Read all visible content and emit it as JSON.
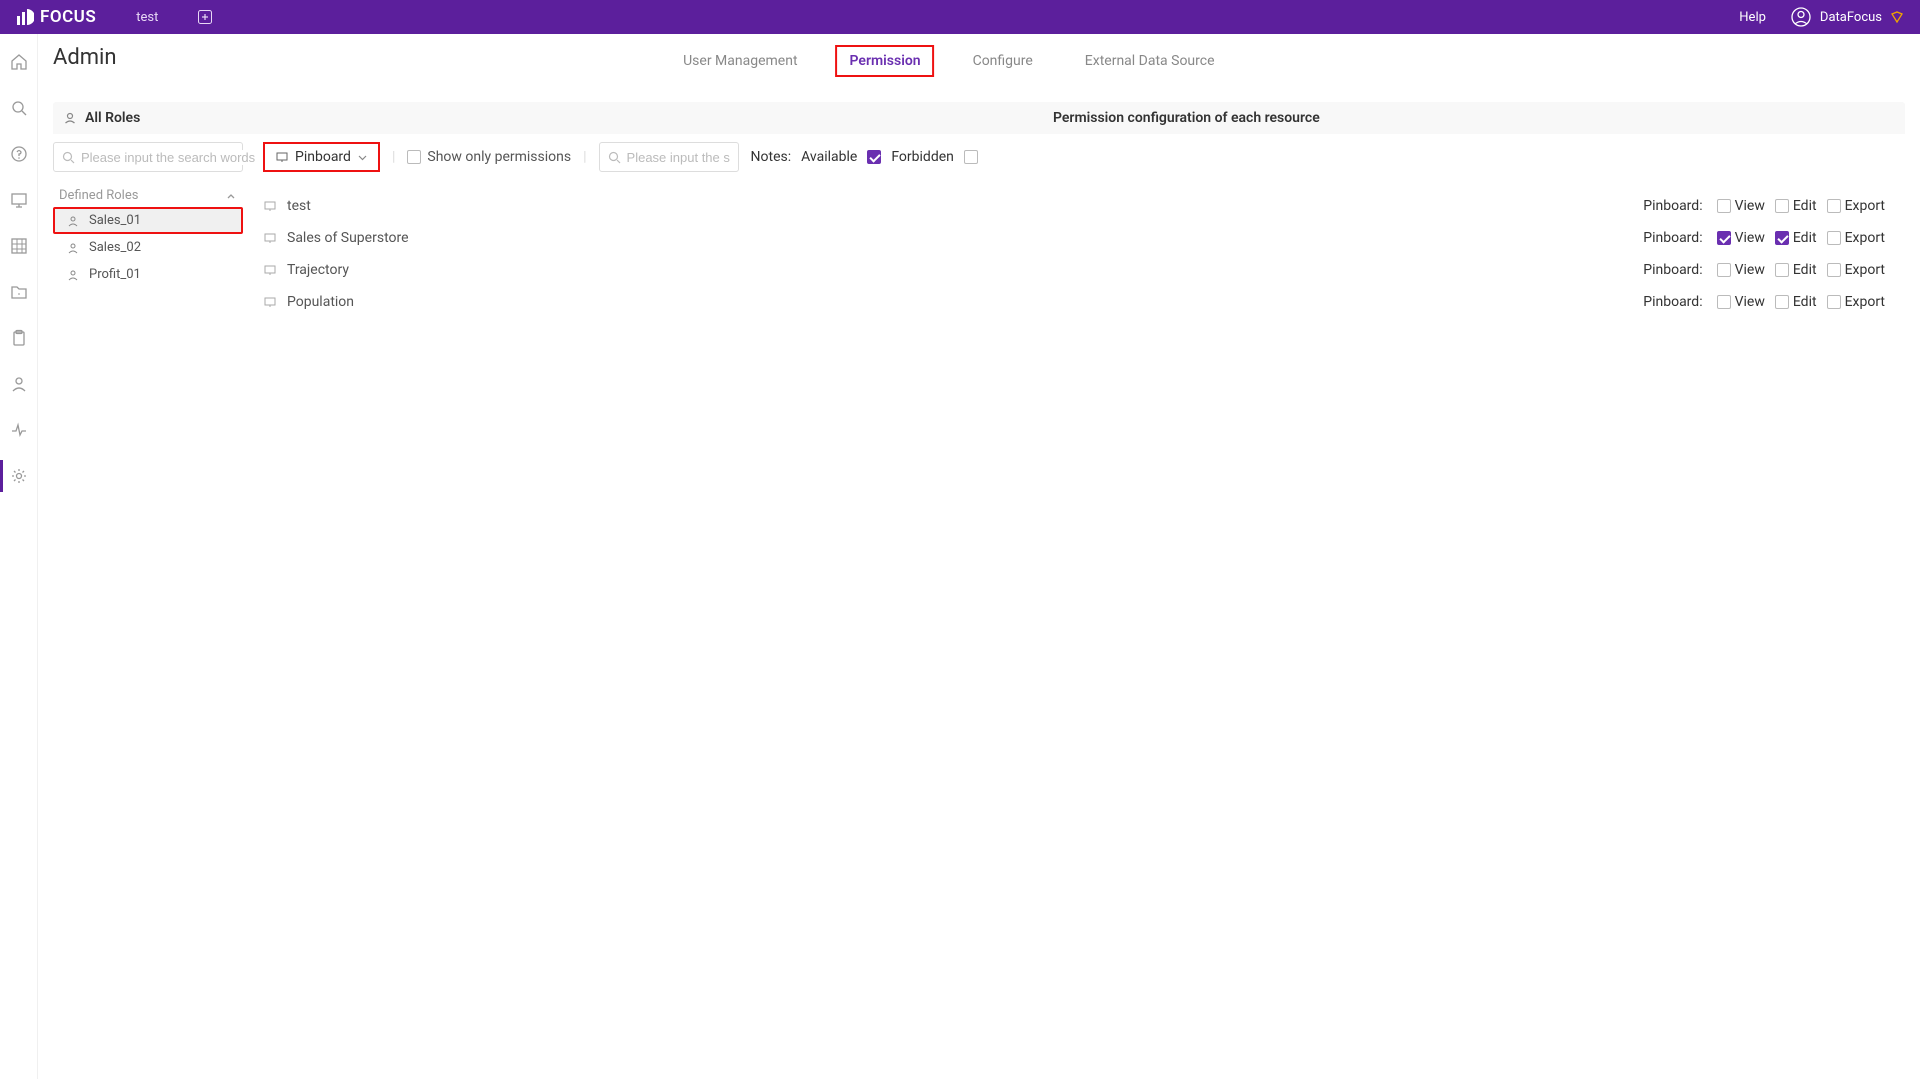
{
  "header": {
    "logo_text": "FOCUS",
    "tab_name": "test",
    "help_label": "Help",
    "user_name": "DataFocus"
  },
  "page_title": "Admin",
  "admin_tabs": [
    {
      "label": "User Management",
      "active": false,
      "highlight": false
    },
    {
      "label": "Permission",
      "active": true,
      "highlight": true
    },
    {
      "label": "Configure",
      "active": false,
      "highlight": false
    },
    {
      "label": "External Data Source",
      "active": false,
      "highlight": false
    }
  ],
  "roles_panel": {
    "title": "All Roles",
    "search_placeholder": "Please input the search words",
    "defined_label": "Defined Roles",
    "roles": [
      {
        "name": "Sales_01",
        "selected": true
      },
      {
        "name": "Sales_02",
        "selected": false
      },
      {
        "name": "Profit_01",
        "selected": false
      }
    ]
  },
  "resource_panel": {
    "title": "Permission configuration of each resource",
    "dropdown_label": "Pinboard",
    "show_only_label": "Show only permissions",
    "search_placeholder": "Please input the search w",
    "notes_label": "Notes:",
    "available_label": "Available",
    "forbidden_label": "Forbidden",
    "perm_type_label": "Pinboard:",
    "perm_view": "View",
    "perm_edit": "Edit",
    "perm_export": "Export",
    "resources": [
      {
        "name": "test",
        "view": false,
        "edit": false,
        "export": false
      },
      {
        "name": "Sales of Superstore",
        "view": true,
        "edit": true,
        "export": false
      },
      {
        "name": "Trajectory",
        "view": false,
        "edit": false,
        "export": false
      },
      {
        "name": "Population",
        "view": false,
        "edit": false,
        "export": false
      }
    ]
  }
}
